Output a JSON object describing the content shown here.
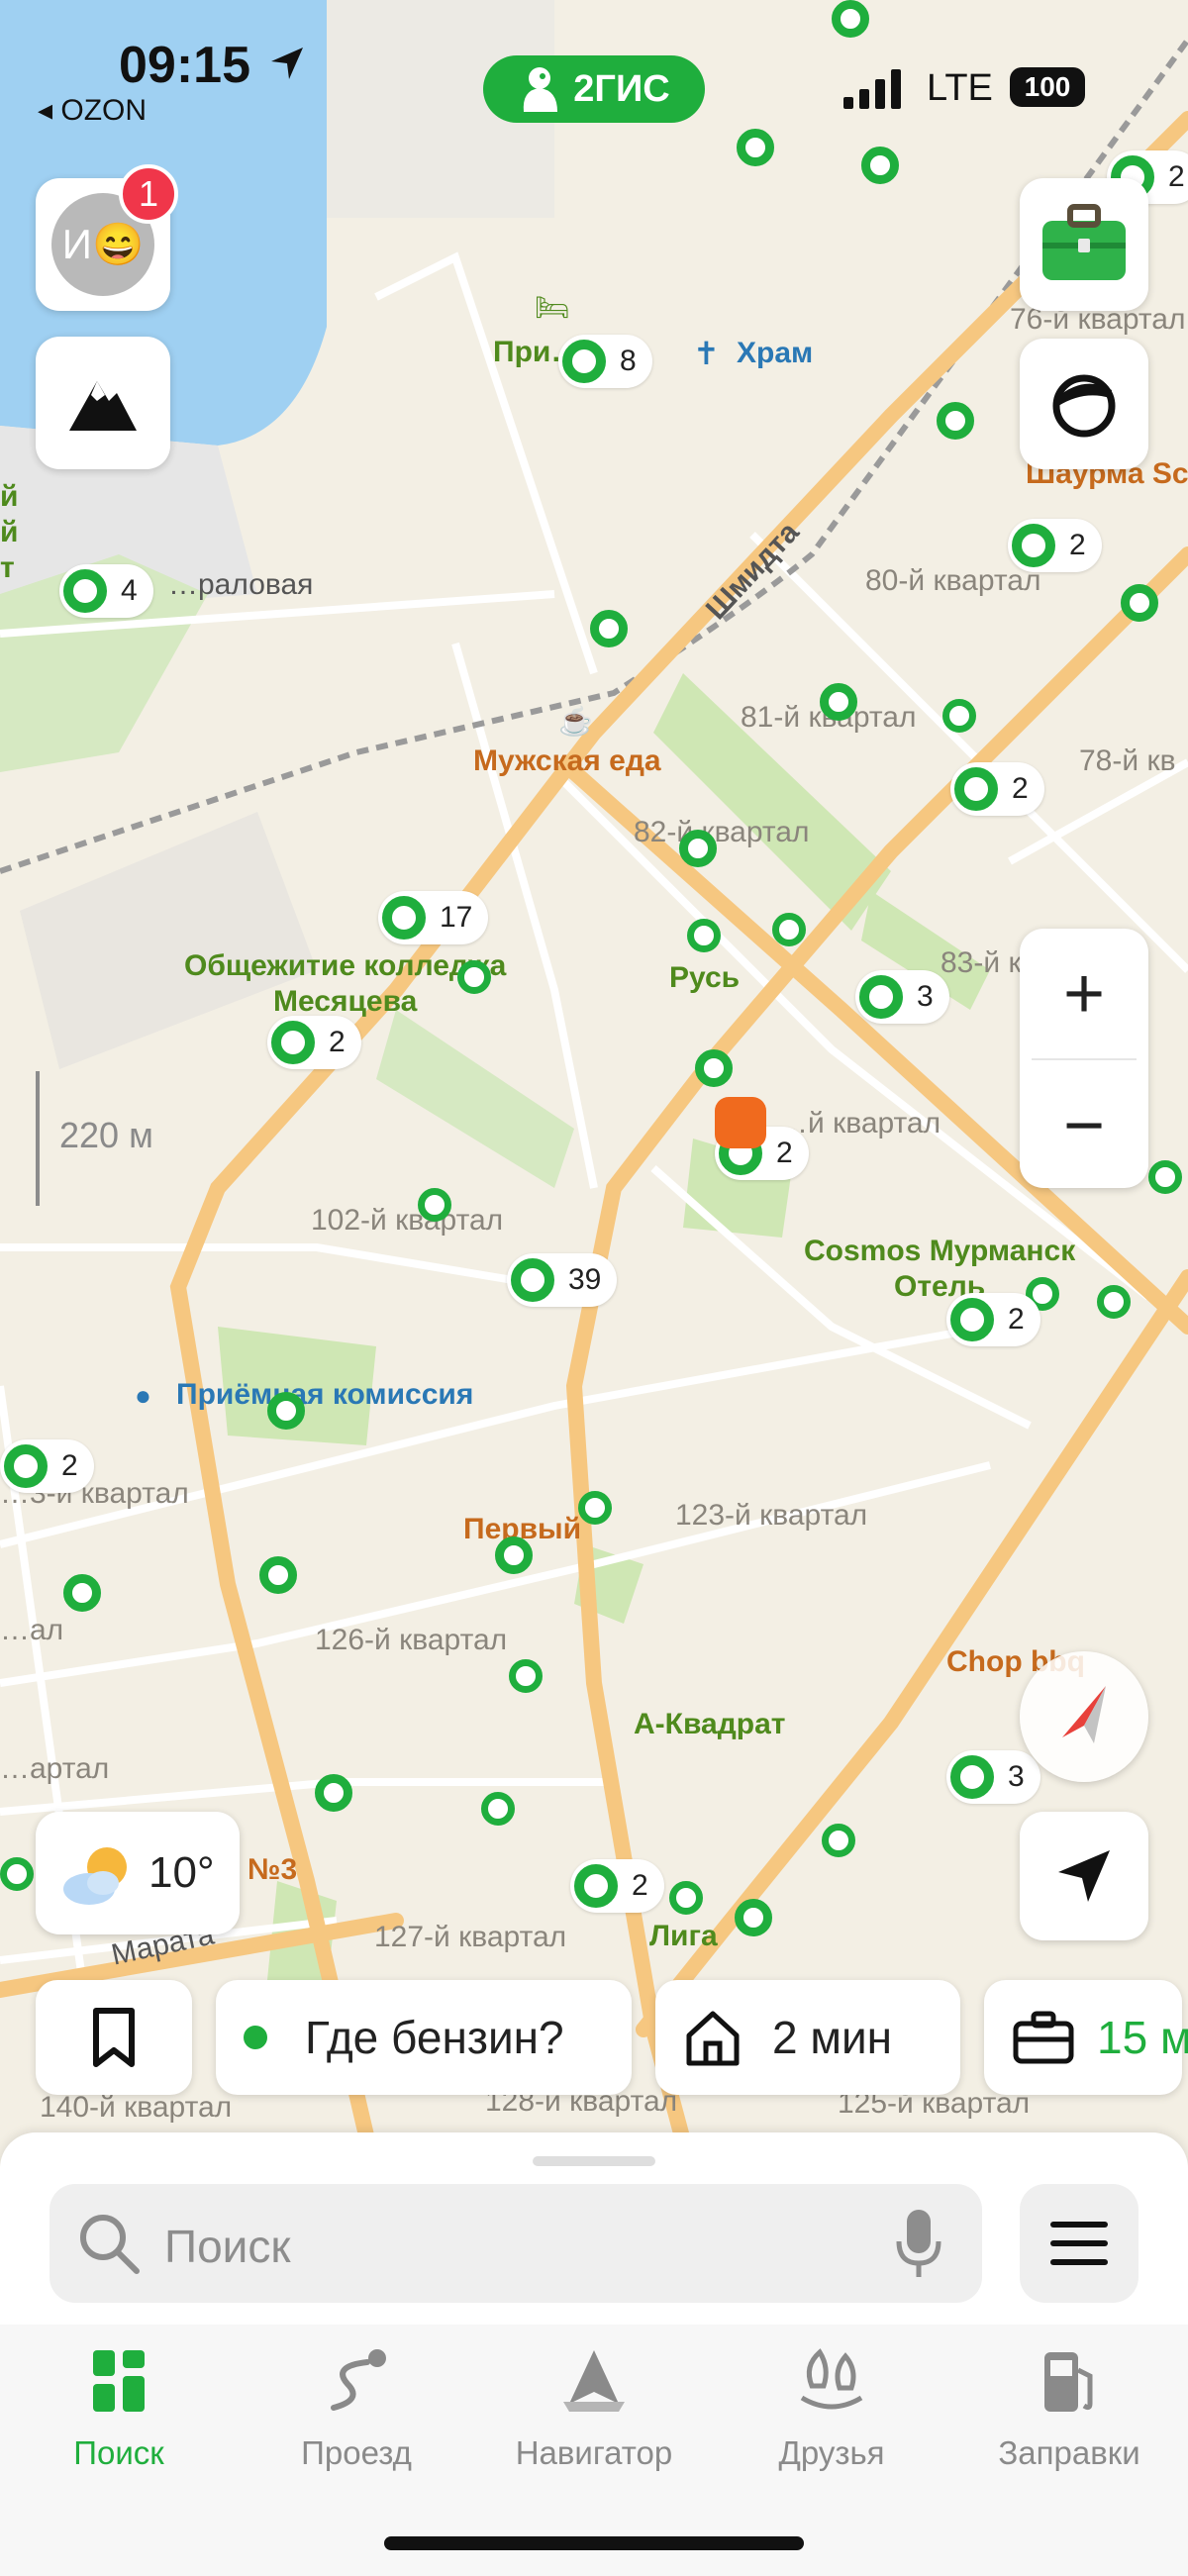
{
  "status": {
    "time": "09:15",
    "carrier": "◂ OZON",
    "brand": "2ГИС",
    "network": "LTE",
    "battery": "100"
  },
  "profile": {
    "initial": "И😄",
    "notifications": "1"
  },
  "map": {
    "scale": "220 м",
    "streets": [
      "Шмидта",
      "Марата",
      "…раловая"
    ],
    "quarters": [
      "76-й квартал",
      "80-й квартал",
      "81-й квартал",
      "78-й кв",
      "82-й квартал",
      "83-й ква",
      "…й квартал",
      "102-й квартал",
      "…3-й квартал",
      "123-й квартал",
      "126-й квартал",
      "…артал",
      "127-й квартал",
      "140-й квартал",
      "128-й квартал",
      "125-й квартал",
      "…ал"
    ],
    "places": {
      "hotel_top": "При…",
      "temple": "Храм",
      "shawarma": "Шаурма Sc",
      "male_food": "Мужская еда",
      "dorm": "Общежитие колледжа\nМесяцева",
      "rus": "Русь",
      "cosmos": "Cosmos Мурманск\nОтель",
      "admissions": "Приёмная комиссия",
      "pervy": "Первый",
      "akvadrat": "А-Квадрат",
      "chop": "Chop bbq",
      "no3": "№3",
      "liga": "Лига",
      "left_edge": "й\nй\nт"
    },
    "clusters": [
      "8",
      "2",
      "2",
      "4",
      "2",
      "17",
      "3",
      "2",
      "2",
      "39",
      "2",
      "2",
      "3",
      "2",
      "2"
    ]
  },
  "weather": {
    "temp": "10°"
  },
  "chips": {
    "fuel": "Где бензин?",
    "home": "2 мин",
    "work": "15 м"
  },
  "search": {
    "placeholder": "Поиск"
  },
  "tabs": [
    "Поиск",
    "Проезд",
    "Навигатор",
    "Друзья",
    "Заправки"
  ],
  "colors": {
    "accent": "#1fae3d",
    "water": "#9fd0f2",
    "road": "#f6c780",
    "park": "#cfe7b4"
  },
  "icons": [
    "briefcase-icon",
    "terrain-icon",
    "sticker-icon",
    "plus-icon",
    "minus-icon",
    "compass-icon",
    "location-arrow-icon",
    "bookmark-icon",
    "home-icon",
    "search-icon",
    "microphone-icon",
    "menu-icon",
    "grid-icon",
    "route-icon",
    "navigator-icon",
    "friends-icon",
    "fuel-icon"
  ]
}
